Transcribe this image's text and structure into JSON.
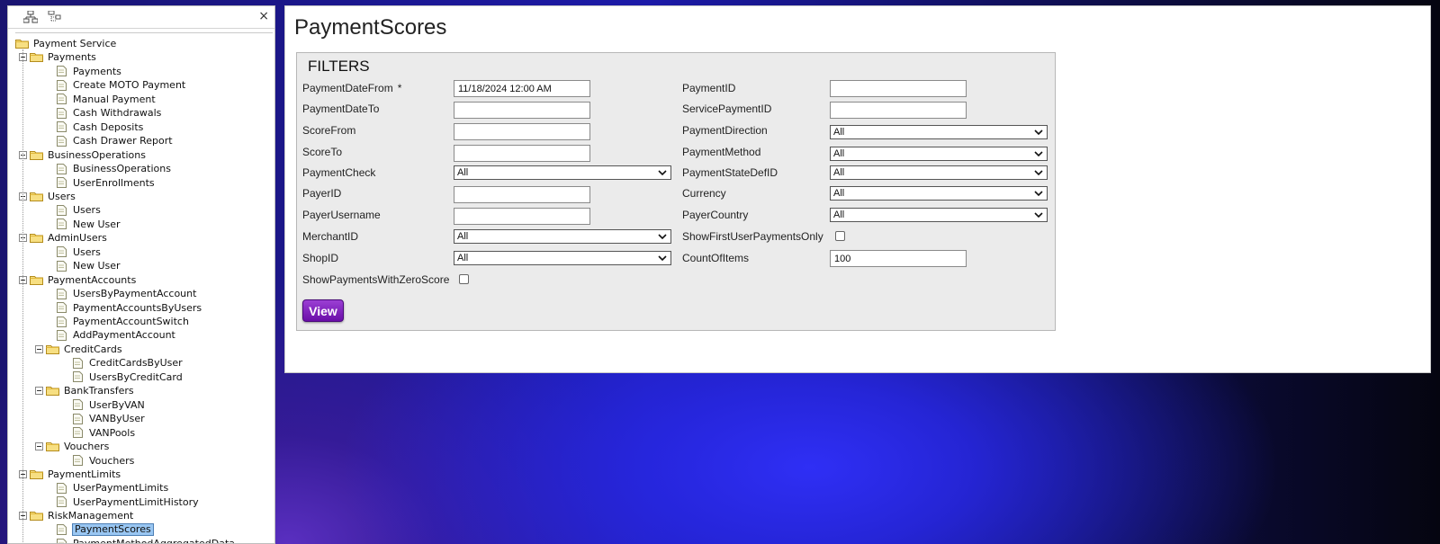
{
  "tree_panel": {
    "close_glyph": "×",
    "toolbar_icons": [
      "expand-tree-icon",
      "collapse-tree-icon"
    ],
    "nodes": [
      {
        "label": "Payment Service",
        "type": "folder"
      },
      {
        "label": "Payments",
        "type": "folder"
      },
      {
        "label": "Payments",
        "type": "page"
      },
      {
        "label": "Create MOTO Payment",
        "type": "page"
      },
      {
        "label": "Manual Payment",
        "type": "page"
      },
      {
        "label": "Cash Withdrawals",
        "type": "page"
      },
      {
        "label": "Cash Deposits",
        "type": "page"
      },
      {
        "label": "Cash Drawer Report",
        "type": "page"
      },
      {
        "label": "BusinessOperations",
        "type": "folder"
      },
      {
        "label": "BusinessOperations",
        "type": "page"
      },
      {
        "label": "UserEnrollments",
        "type": "page"
      },
      {
        "label": "Users",
        "type": "folder"
      },
      {
        "label": "Users",
        "type": "page"
      },
      {
        "label": "New User",
        "type": "page"
      },
      {
        "label": "AdminUsers",
        "type": "folder"
      },
      {
        "label": "Users",
        "type": "page"
      },
      {
        "label": "New User",
        "type": "page"
      },
      {
        "label": "PaymentAccounts",
        "type": "folder"
      },
      {
        "label": "UsersByPaymentAccount",
        "type": "page"
      },
      {
        "label": "PaymentAccountsByUsers",
        "type": "page"
      },
      {
        "label": "PaymentAccountSwitch",
        "type": "page"
      },
      {
        "label": "AddPaymentAccount",
        "type": "page"
      },
      {
        "label": "CreditCards",
        "type": "folder"
      },
      {
        "label": "CreditCardsByUser",
        "type": "page"
      },
      {
        "label": "UsersByCreditCard",
        "type": "page"
      },
      {
        "label": "BankTransfers",
        "type": "folder"
      },
      {
        "label": "UserByVAN",
        "type": "page"
      },
      {
        "label": "VANByUser",
        "type": "page"
      },
      {
        "label": "VANPools",
        "type": "page"
      },
      {
        "label": "Vouchers",
        "type": "folder"
      },
      {
        "label": "Vouchers",
        "type": "page"
      },
      {
        "label": "PaymentLimits",
        "type": "folder"
      },
      {
        "label": "UserPaymentLimits",
        "type": "page"
      },
      {
        "label": "UserPaymentLimitHistory",
        "type": "page"
      },
      {
        "label": "RiskManagement",
        "type": "folder"
      },
      {
        "label": "PaymentScores",
        "type": "page",
        "selected": true
      },
      {
        "label": "PaymentMethodAggregatedData",
        "type": "page"
      }
    ]
  },
  "main": {
    "title": "PaymentScores",
    "filters": {
      "legend": "FILTERS",
      "left": {
        "payment_date_from": {
          "label": "PaymentDateFrom",
          "required_mark": "*",
          "value": "11/18/2024 12:00 AM"
        },
        "payment_date_to": {
          "label": "PaymentDateTo",
          "value": ""
        },
        "score_from": {
          "label": "ScoreFrom",
          "value": ""
        },
        "score_to": {
          "label": "ScoreTo",
          "value": ""
        },
        "payment_check": {
          "label": "PaymentCheck",
          "selected": "All"
        },
        "payer_id": {
          "label": "PayerID",
          "value": ""
        },
        "payer_username": {
          "label": "PayerUsername",
          "value": ""
        },
        "merchant_id": {
          "label": "MerchantID",
          "selected": "All"
        },
        "shop_id": {
          "label": "ShopID",
          "selected": "All"
        },
        "show_zero_score": {
          "label": "ShowPaymentsWithZeroScore",
          "checked": false
        }
      },
      "right": {
        "payment_id": {
          "label": "PaymentID",
          "value": ""
        },
        "service_payment_id": {
          "label": "ServicePaymentID",
          "value": ""
        },
        "payment_direction": {
          "label": "PaymentDirection",
          "selected": "All"
        },
        "payment_method": {
          "label": "PaymentMethod",
          "selected": "All"
        },
        "payment_state_def_id": {
          "label": "PaymentStateDefID",
          "selected": "All"
        },
        "currency": {
          "label": "Currency",
          "selected": "All"
        },
        "payer_country": {
          "label": "PayerCountry",
          "selected": "All"
        },
        "show_first_user_payments": {
          "label": "ShowFirstUserPaymentsOnly",
          "checked": false
        },
        "count_of_items": {
          "label": "CountOfItems",
          "value": "100"
        }
      },
      "view_button": "View"
    }
  }
}
